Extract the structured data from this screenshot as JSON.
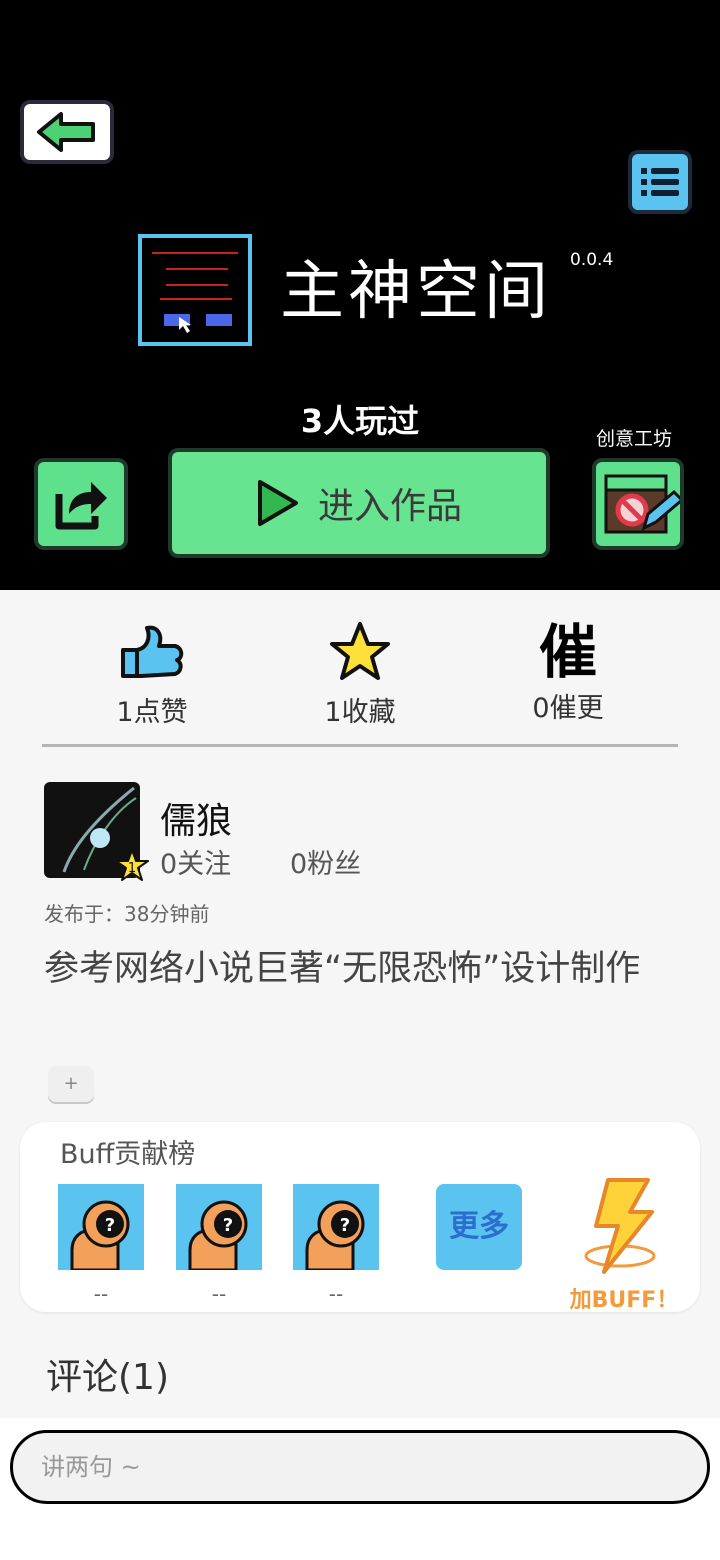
{
  "header": {
    "title": "主神空间",
    "version": "0.0.4",
    "played": "3人玩过",
    "workshop_label": "创意工坊",
    "enter_label": "进入作品"
  },
  "stats": [
    {
      "label": "1点赞",
      "icon": "thumbs-up-icon"
    },
    {
      "label": "1收藏",
      "icon": "star-icon"
    },
    {
      "label": "0催更",
      "icon": "urge-icon",
      "glyph": "催"
    }
  ],
  "author": {
    "name": "儒狼",
    "level": "1",
    "follow": "0关注",
    "fans": "0粉丝",
    "posted": "发布于：38分钟前"
  },
  "description": "参考网络小说巨著“无限恐怖”设计制作",
  "plus_label": "+",
  "buff": {
    "title": "Buff贡献榜",
    "slots": [
      "--",
      "--",
      "--"
    ],
    "more_label": "更多",
    "add_label": "加BUFF！"
  },
  "comments_title": "评论(1)",
  "comment_input": {
    "placeholder": "讲两句 ~"
  },
  "colors": {
    "green": "#67e48f",
    "blue": "#5bc3ef",
    "black": "#000000",
    "orange": "#f39a3c"
  }
}
